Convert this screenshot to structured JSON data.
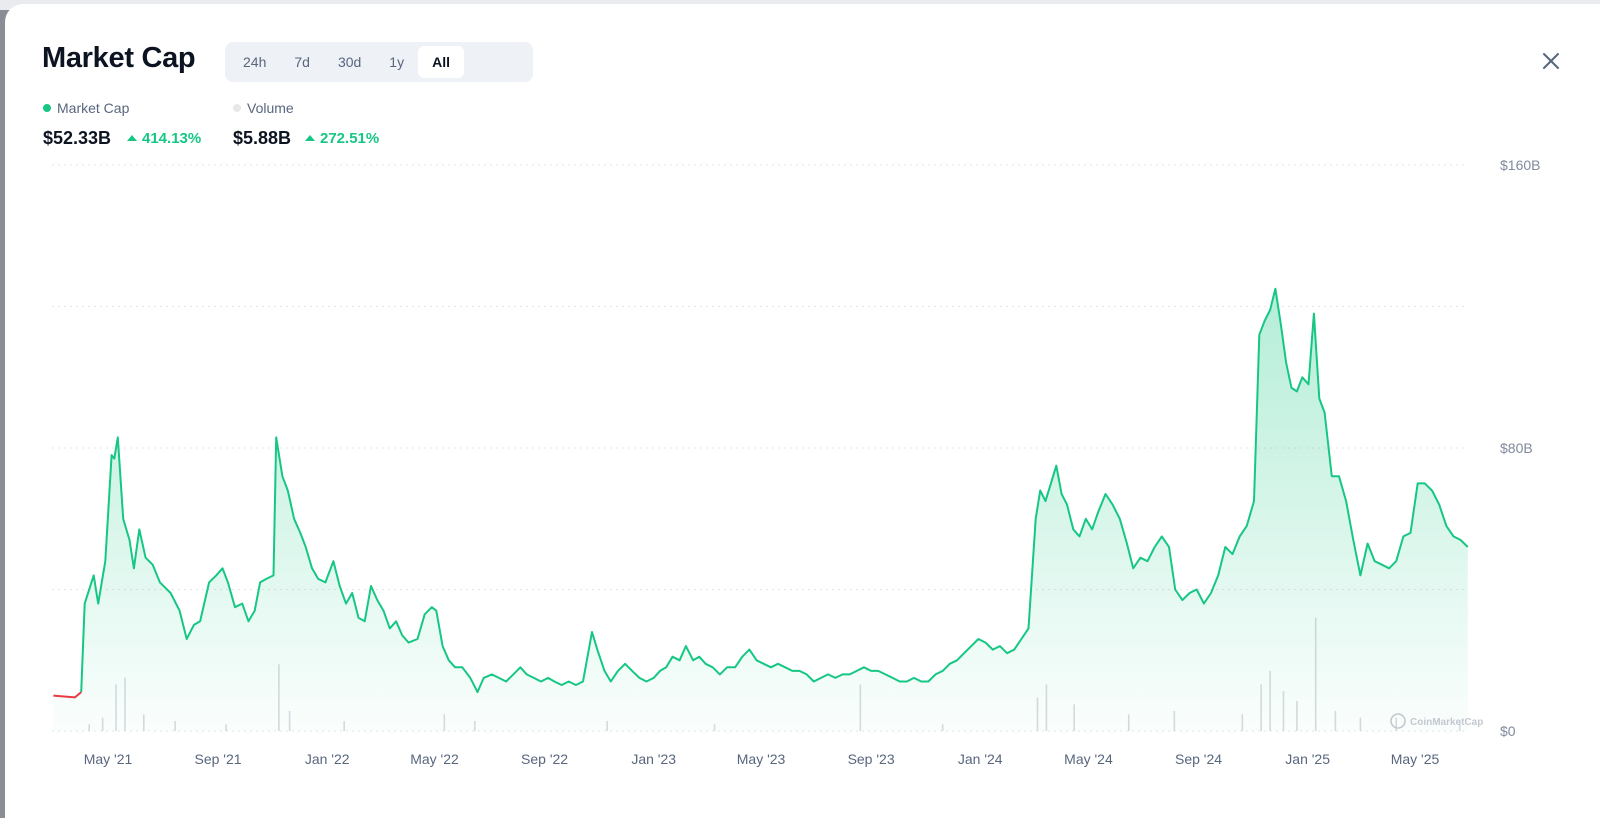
{
  "header": {
    "title": "Market Cap",
    "ranges": [
      "24h",
      "7d",
      "30d",
      "1y",
      "All"
    ],
    "active_range": "All"
  },
  "legend": {
    "market_cap": {
      "label": "Market Cap",
      "value": "$52.33B",
      "change": "414.13%",
      "color": "#16c784"
    },
    "volume": {
      "label": "Volume",
      "value": "$5.88B",
      "change": "272.51%",
      "color": "#e6e8ea"
    }
  },
  "watermark": "CoinMarketCap",
  "colors": {
    "up": "#16c784",
    "down": "#ea3943",
    "volume_bar": "#d7dbe1",
    "grid": "#e3e6eb"
  },
  "chart_data": {
    "type": "area",
    "series": [
      {
        "name": "Market Cap",
        "unit": "$B",
        "points": [
          [
            "2021-03-01",
            10
          ],
          [
            "2021-03-25",
            9.5
          ],
          [
            "2021-04-01",
            11
          ],
          [
            "2021-04-05",
            36
          ],
          [
            "2021-04-15",
            44
          ],
          [
            "2021-04-20",
            36
          ],
          [
            "2021-04-28",
            48
          ],
          [
            "2021-05-05",
            78
          ],
          [
            "2021-05-08",
            77
          ],
          [
            "2021-05-12",
            83
          ],
          [
            "2021-05-18",
            60
          ],
          [
            "2021-05-25",
            54
          ],
          [
            "2021-05-30",
            46
          ],
          [
            "2021-06-05",
            57
          ],
          [
            "2021-06-12",
            49
          ],
          [
            "2021-06-20",
            47
          ],
          [
            "2021-06-28",
            42
          ],
          [
            "2021-07-10",
            39
          ],
          [
            "2021-07-20",
            34
          ],
          [
            "2021-07-28",
            26
          ],
          [
            "2021-08-05",
            30
          ],
          [
            "2021-08-12",
            31
          ],
          [
            "2021-08-22",
            42
          ],
          [
            "2021-08-30",
            44
          ],
          [
            "2021-09-06",
            46
          ],
          [
            "2021-09-12",
            42
          ],
          [
            "2021-09-20",
            35
          ],
          [
            "2021-09-28",
            36
          ],
          [
            "2021-10-05",
            31
          ],
          [
            "2021-10-12",
            34
          ],
          [
            "2021-10-18",
            42
          ],
          [
            "2021-10-25",
            43
          ],
          [
            "2021-11-02",
            44
          ],
          [
            "2021-11-05",
            83
          ],
          [
            "2021-11-12",
            72
          ],
          [
            "2021-11-18",
            68
          ],
          [
            "2021-11-25",
            60
          ],
          [
            "2021-12-02",
            56
          ],
          [
            "2021-12-08",
            52
          ],
          [
            "2021-12-15",
            46
          ],
          [
            "2021-12-22",
            43
          ],
          [
            "2021-12-30",
            42
          ],
          [
            "2022-01-08",
            48
          ],
          [
            "2022-01-15",
            41
          ],
          [
            "2022-01-22",
            36
          ],
          [
            "2022-01-29",
            39
          ],
          [
            "2022-02-05",
            32
          ],
          [
            "2022-02-12",
            31
          ],
          [
            "2022-02-19",
            41
          ],
          [
            "2022-02-26",
            37
          ],
          [
            "2022-03-05",
            34
          ],
          [
            "2022-03-12",
            29
          ],
          [
            "2022-03-19",
            31
          ],
          [
            "2022-03-26",
            27
          ],
          [
            "2022-04-02",
            25
          ],
          [
            "2022-04-12",
            26
          ],
          [
            "2022-04-20",
            33
          ],
          [
            "2022-04-28",
            35
          ],
          [
            "2022-05-03",
            34
          ],
          [
            "2022-05-10",
            24
          ],
          [
            "2022-05-17",
            20
          ],
          [
            "2022-05-24",
            18
          ],
          [
            "2022-06-01",
            18
          ],
          [
            "2022-06-10",
            15
          ],
          [
            "2022-06-18",
            11
          ],
          [
            "2022-06-25",
            15
          ],
          [
            "2022-07-04",
            16
          ],
          [
            "2022-07-12",
            15
          ],
          [
            "2022-07-20",
            14
          ],
          [
            "2022-07-28",
            16
          ],
          [
            "2022-08-05",
            18
          ],
          [
            "2022-08-12",
            16
          ],
          [
            "2022-08-20",
            15
          ],
          [
            "2022-08-28",
            14
          ],
          [
            "2022-09-05",
            15
          ],
          [
            "2022-09-12",
            14
          ],
          [
            "2022-09-20",
            13
          ],
          [
            "2022-09-28",
            14
          ],
          [
            "2022-10-06",
            13
          ],
          [
            "2022-10-14",
            14
          ],
          [
            "2022-10-24",
            28
          ],
          [
            "2022-10-30",
            23
          ],
          [
            "2022-11-07",
            17
          ],
          [
            "2022-11-14",
            14
          ],
          [
            "2022-11-22",
            17
          ],
          [
            "2022-11-30",
            19
          ],
          [
            "2022-12-08",
            17
          ],
          [
            "2022-12-16",
            15
          ],
          [
            "2022-12-24",
            14
          ],
          [
            "2023-01-01",
            15
          ],
          [
            "2023-01-08",
            17
          ],
          [
            "2023-01-15",
            18
          ],
          [
            "2023-01-22",
            21
          ],
          [
            "2023-01-30",
            20
          ],
          [
            "2023-02-06",
            24
          ],
          [
            "2023-02-14",
            20
          ],
          [
            "2023-02-21",
            21
          ],
          [
            "2023-02-28",
            19
          ],
          [
            "2023-03-08",
            18
          ],
          [
            "2023-03-16",
            16
          ],
          [
            "2023-03-24",
            18
          ],
          [
            "2023-04-02",
            18
          ],
          [
            "2023-04-10",
            21
          ],
          [
            "2023-04-18",
            23
          ],
          [
            "2023-04-26",
            20
          ],
          [
            "2023-05-04",
            19
          ],
          [
            "2023-05-12",
            18
          ],
          [
            "2023-05-20",
            19
          ],
          [
            "2023-05-28",
            18
          ],
          [
            "2023-06-05",
            17
          ],
          [
            "2023-06-13",
            17
          ],
          [
            "2023-06-21",
            16
          ],
          [
            "2023-06-29",
            14
          ],
          [
            "2023-07-07",
            15
          ],
          [
            "2023-07-15",
            16
          ],
          [
            "2023-07-23",
            15
          ],
          [
            "2023-07-31",
            16
          ],
          [
            "2023-08-08",
            16
          ],
          [
            "2023-08-16",
            17
          ],
          [
            "2023-08-24",
            18
          ],
          [
            "2023-09-01",
            17
          ],
          [
            "2023-09-09",
            17
          ],
          [
            "2023-09-17",
            16
          ],
          [
            "2023-09-25",
            15
          ],
          [
            "2023-10-03",
            14
          ],
          [
            "2023-10-11",
            14
          ],
          [
            "2023-10-19",
            15
          ],
          [
            "2023-10-27",
            14
          ],
          [
            "2023-11-04",
            14
          ],
          [
            "2023-11-12",
            16
          ],
          [
            "2023-11-20",
            17
          ],
          [
            "2023-11-28",
            19
          ],
          [
            "2023-12-06",
            20
          ],
          [
            "2023-12-14",
            22
          ],
          [
            "2023-12-22",
            24
          ],
          [
            "2023-12-30",
            26
          ],
          [
            "2024-01-07",
            25
          ],
          [
            "2024-01-15",
            23
          ],
          [
            "2024-01-23",
            24
          ],
          [
            "2024-01-31",
            22
          ],
          [
            "2024-02-08",
            23
          ],
          [
            "2024-02-16",
            26
          ],
          [
            "2024-02-24",
            29
          ],
          [
            "2024-03-03",
            60
          ],
          [
            "2024-03-08",
            68
          ],
          [
            "2024-03-14",
            65
          ],
          [
            "2024-03-20",
            70
          ],
          [
            "2024-03-26",
            75
          ],
          [
            "2024-04-01",
            67
          ],
          [
            "2024-04-07",
            64
          ],
          [
            "2024-04-14",
            57
          ],
          [
            "2024-04-21",
            55
          ],
          [
            "2024-04-28",
            60
          ],
          [
            "2024-05-05",
            57
          ],
          [
            "2024-05-12",
            62
          ],
          [
            "2024-05-20",
            67
          ],
          [
            "2024-05-28",
            64
          ],
          [
            "2024-06-05",
            60
          ],
          [
            "2024-06-13",
            53
          ],
          [
            "2024-06-20",
            46
          ],
          [
            "2024-06-28",
            49
          ],
          [
            "2024-07-06",
            48
          ],
          [
            "2024-07-14",
            52
          ],
          [
            "2024-07-22",
            55
          ],
          [
            "2024-07-30",
            52
          ],
          [
            "2024-08-06",
            40
          ],
          [
            "2024-08-14",
            37
          ],
          [
            "2024-08-22",
            39
          ],
          [
            "2024-08-30",
            40
          ],
          [
            "2024-09-07",
            36
          ],
          [
            "2024-09-15",
            39
          ],
          [
            "2024-09-23",
            44
          ],
          [
            "2024-10-01",
            52
          ],
          [
            "2024-10-09",
            50
          ],
          [
            "2024-10-17",
            55
          ],
          [
            "2024-10-25",
            58
          ],
          [
            "2024-11-02",
            65
          ],
          [
            "2024-11-08",
            112
          ],
          [
            "2024-11-14",
            116
          ],
          [
            "2024-11-20",
            119
          ],
          [
            "2024-11-26",
            125
          ],
          [
            "2024-12-02",
            115
          ],
          [
            "2024-12-08",
            104
          ],
          [
            "2024-12-14",
            97
          ],
          [
            "2024-12-20",
            96
          ],
          [
            "2024-12-26",
            100
          ],
          [
            "2025-01-02",
            98
          ],
          [
            "2025-01-08",
            118
          ],
          [
            "2025-01-14",
            94
          ],
          [
            "2025-01-20",
            90
          ],
          [
            "2025-01-28",
            72
          ],
          [
            "2025-02-05",
            72
          ],
          [
            "2025-02-13",
            65
          ],
          [
            "2025-02-21",
            54
          ],
          [
            "2025-03-01",
            44
          ],
          [
            "2025-03-09",
            53
          ],
          [
            "2025-03-17",
            48
          ],
          [
            "2025-03-25",
            47
          ],
          [
            "2025-04-02",
            46
          ],
          [
            "2025-04-10",
            48
          ],
          [
            "2025-04-18",
            55
          ],
          [
            "2025-04-26",
            56
          ],
          [
            "2025-05-04",
            70
          ],
          [
            "2025-05-12",
            70
          ],
          [
            "2025-05-20",
            68
          ],
          [
            "2025-05-28",
            64
          ],
          [
            "2025-06-05",
            58
          ],
          [
            "2025-06-13",
            55
          ],
          [
            "2025-06-21",
            54
          ],
          [
            "2025-06-29",
            52
          ]
        ]
      },
      {
        "name": "Volume",
        "unit": "$B",
        "bars": [
          [
            "2021-04-10",
            2
          ],
          [
            "2021-04-25",
            4
          ],
          [
            "2021-05-10",
            14
          ],
          [
            "2021-05-20",
            16
          ],
          [
            "2021-06-10",
            5
          ],
          [
            "2021-07-15",
            3
          ],
          [
            "2021-09-10",
            2
          ],
          [
            "2021-11-08",
            20
          ],
          [
            "2021-11-20",
            6
          ],
          [
            "2022-01-20",
            3
          ],
          [
            "2022-05-12",
            5
          ],
          [
            "2022-06-15",
            3
          ],
          [
            "2022-11-10",
            3
          ],
          [
            "2023-03-10",
            2
          ],
          [
            "2023-08-20",
            14
          ],
          [
            "2023-11-20",
            2
          ],
          [
            "2024-03-05",
            10
          ],
          [
            "2024-03-15",
            14
          ],
          [
            "2024-04-15",
            8
          ],
          [
            "2024-06-15",
            5
          ],
          [
            "2024-08-05",
            6
          ],
          [
            "2024-10-20",
            5
          ],
          [
            "2024-11-10",
            14
          ],
          [
            "2024-11-20",
            18
          ],
          [
            "2024-12-05",
            12
          ],
          [
            "2024-12-20",
            9
          ],
          [
            "2025-01-10",
            34
          ],
          [
            "2025-02-01",
            6
          ],
          [
            "2025-03-01",
            4
          ],
          [
            "2025-04-10",
            4
          ],
          [
            "2025-06-20",
            3
          ]
        ]
      }
    ],
    "xlabels": [
      "May '21",
      "Sep '21",
      "Jan '22",
      "May '22",
      "Sep '22",
      "Jan '23",
      "May '23",
      "Sep '23",
      "Jan '24",
      "May '24",
      "Sep '24",
      "Jan '25",
      "May '25"
    ],
    "ylabels": [
      "$160B",
      "$80B",
      "$0"
    ],
    "ylim": [
      0,
      160
    ],
    "grid": true,
    "yaxis_side": "right"
  }
}
